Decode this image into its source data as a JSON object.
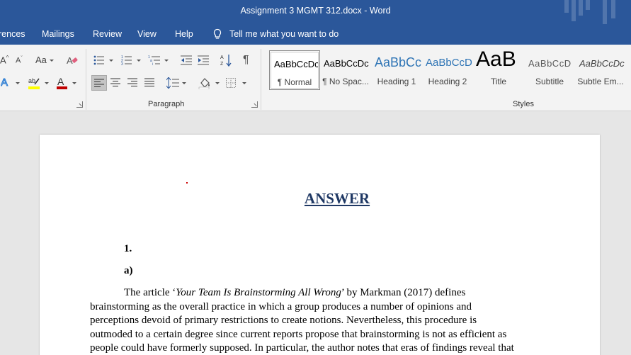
{
  "window": {
    "title": "Assignment 3 MGMT 312.docx  -  Word"
  },
  "tabs": [
    {
      "label": "rences"
    },
    {
      "label": "Mailings"
    },
    {
      "label": "Review"
    },
    {
      "label": "View"
    },
    {
      "label": "Help"
    }
  ],
  "tell_me": {
    "text": "Tell me what you want to do"
  },
  "ribbon": {
    "change_case_label": "Aa",
    "paragraph_label": "Paragraph",
    "styles_label": "Styles",
    "styles": [
      {
        "sample": "AaBbCcDc",
        "name": "¶ Normal"
      },
      {
        "sample": "AaBbCcDc",
        "name": "¶ No Spac..."
      },
      {
        "sample": "AaBbCc",
        "name": "Heading 1"
      },
      {
        "sample": "AaBbCcD",
        "name": "Heading 2"
      },
      {
        "sample": "AaB",
        "name": "Title"
      },
      {
        "sample": "AaBbCcD",
        "name": "Subtitle"
      },
      {
        "sample": "AaBbCcDc",
        "name": "Subtle Em..."
      }
    ]
  },
  "document": {
    "heading": "ANSWER",
    "q_number": "1.",
    "q_part": "a)",
    "para": {
      "l1_pre": "The article ‘",
      "l1_italic": "Your Team Is Brainstorming All Wrong",
      "l1_post": "’ by Markman (2017) defines",
      "l2": "brainstorming as the overall practice in which a group produces a number of opinions and",
      "l3": "perceptions devoid of primary restrictions to create notions. Nevertheless, this procedure is",
      "l4": "outmoded to a certain degree since current reports propose that brainstorming is not as efficient as",
      "l5": "people could have formerly supposed. In particular, the author notes that eras of findings reveal that"
    }
  },
  "colors": {
    "word_blue": "#2b579a",
    "ribbon_bg": "#f3f3f3",
    "heading_blue": "#2e74b5",
    "answer_color": "#1f3864",
    "highlight_yellow": "#ffff00",
    "font_color_red": "#c00000"
  }
}
